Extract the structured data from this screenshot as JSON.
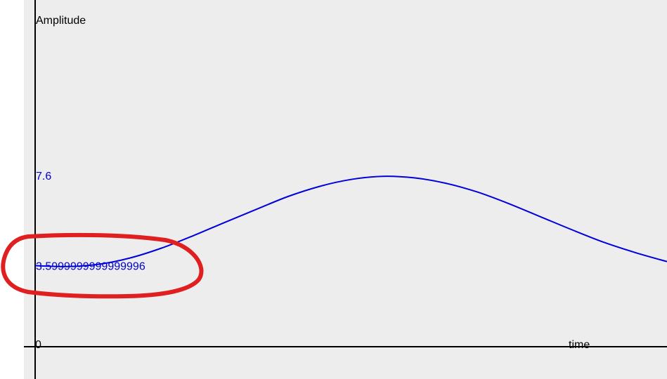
{
  "chart_data": {
    "type": "line",
    "ylabel": "Amplitude",
    "xlabel": "time",
    "x_tick_label": "0",
    "y_tick_labels": [
      "7.6",
      "3.5999999999999996"
    ],
    "y_ticks": [
      7.6,
      3.5999999999999996
    ],
    "ylim": [
      0,
      15.4
    ],
    "grid": false,
    "series": [
      {
        "color": "#0000dd",
        "x": [
          0,
          0.05,
          0.1,
          0.15,
          0.2,
          0.25,
          0.3,
          0.35,
          0.4,
          0.45,
          0.5,
          0.55,
          0.6,
          0.65,
          0.7,
          0.75,
          0.8,
          0.85,
          0.9,
          0.95,
          1.0
        ],
        "values": [
          3.6,
          3.56,
          3.66,
          3.94,
          4.38,
          4.93,
          5.52,
          6.1,
          6.67,
          7.12,
          7.43,
          7.57,
          7.5,
          7.26,
          6.87,
          6.35,
          5.77,
          5.19,
          4.64,
          4.18,
          3.78
        ]
      }
    ],
    "annotations": [
      {
        "type": "hand-drawn-ellipse",
        "target_label": "3.5999999999999996",
        "color": "#e02020"
      }
    ],
    "colors": {
      "axis": "#000000",
      "tick_label": "#0000cc",
      "background": "#ededed",
      "highlight": "#e02020"
    }
  }
}
